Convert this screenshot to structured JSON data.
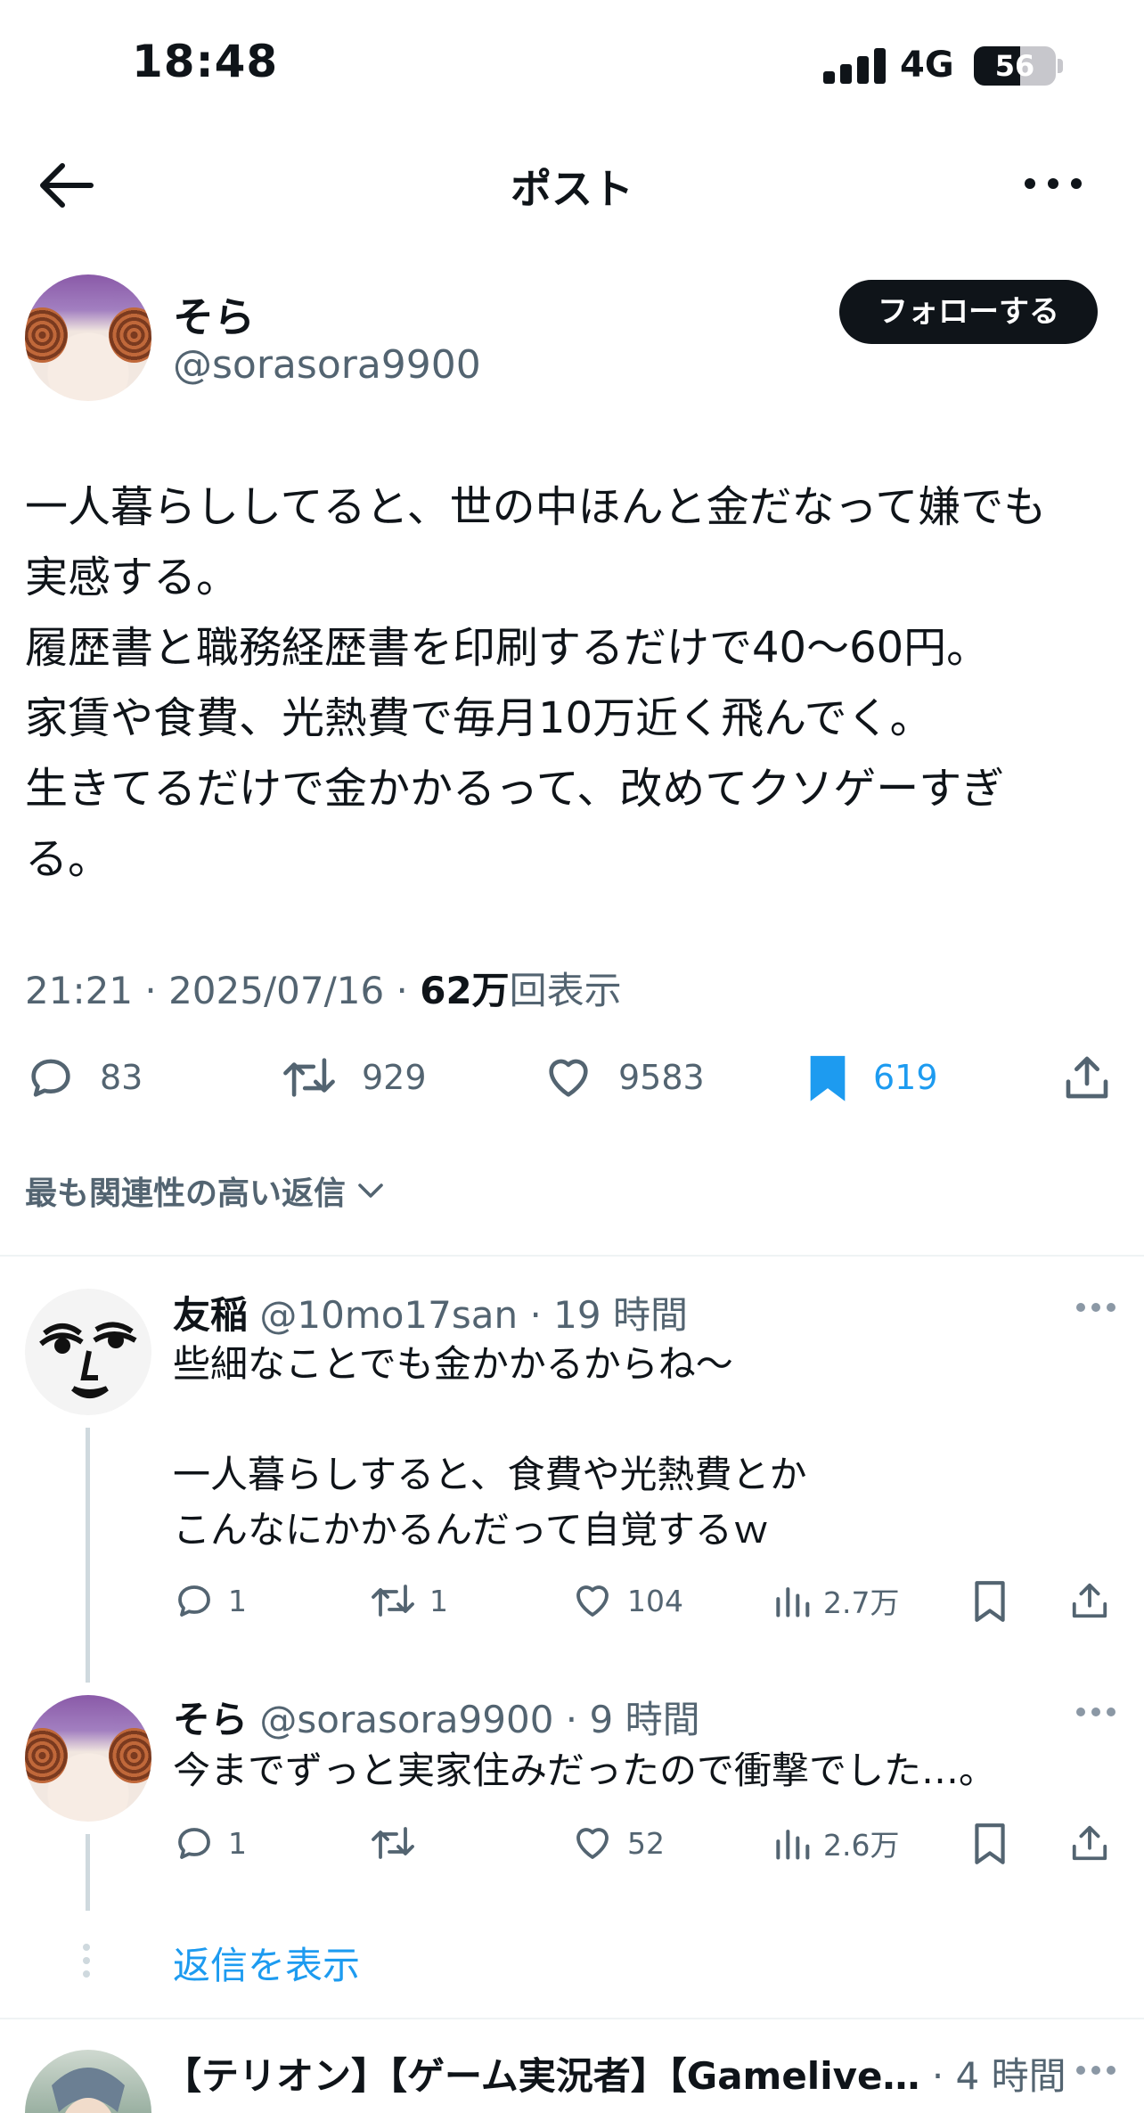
{
  "status_bar": {
    "time": "18:48",
    "network": "4G",
    "battery": "56",
    "battery_level": 0.56
  },
  "header": {
    "title": "ポスト"
  },
  "post": {
    "author_name": "そら",
    "author_handle": "@sorasora9900",
    "follow_label": "フォローする",
    "text": "一人暮らししてると、世の中ほんと金だなって嫌でも\n実感する。\n履歴書と職務経歴書を印刷するだけで40〜60円。\n家賃や食費、光熱費で毎月10万近く飛んでく。\n生きてるだけで金かかるって、改めてクソゲーすぎ\nる。",
    "time": "21:21 · 2025/07/16 · ",
    "views_count": "62万",
    "views_label": "回表示",
    "stats": {
      "replies": "83",
      "reposts": "929",
      "likes": "9583",
      "bookmarks": "619"
    }
  },
  "sort_label": "最も関連性の高い返信",
  "replies": [
    {
      "name": "友稲",
      "handle": "@10mo17san",
      "age": "· 19 時間",
      "text": "些細なことでも金かかるからね〜\n\n一人暮らしすると、食費や光熱費とか\nこんなにかかるんだって自覚するｗ",
      "stats": {
        "replies": "1",
        "reposts": "1",
        "likes": "104",
        "views": "2.7万"
      }
    },
    {
      "name": "そら",
      "handle": "@sorasora9900",
      "age": "· 9 時間",
      "text": "今までずっと実家住みだったので衝撃でした…。",
      "stats": {
        "replies": "1",
        "reposts": "",
        "likes": "52",
        "views": "2.6万"
      }
    },
    {
      "name": "【テリオン】【ゲーム実況者】【Gamelive…",
      "handle": "",
      "age": "· 4 時間"
    }
  ],
  "show_replies_label": "返信を表示",
  "colors": {
    "text": "#0f1419",
    "secondary": "#536471",
    "accent": "#1d9bf0",
    "divider": "#eff3f4"
  }
}
